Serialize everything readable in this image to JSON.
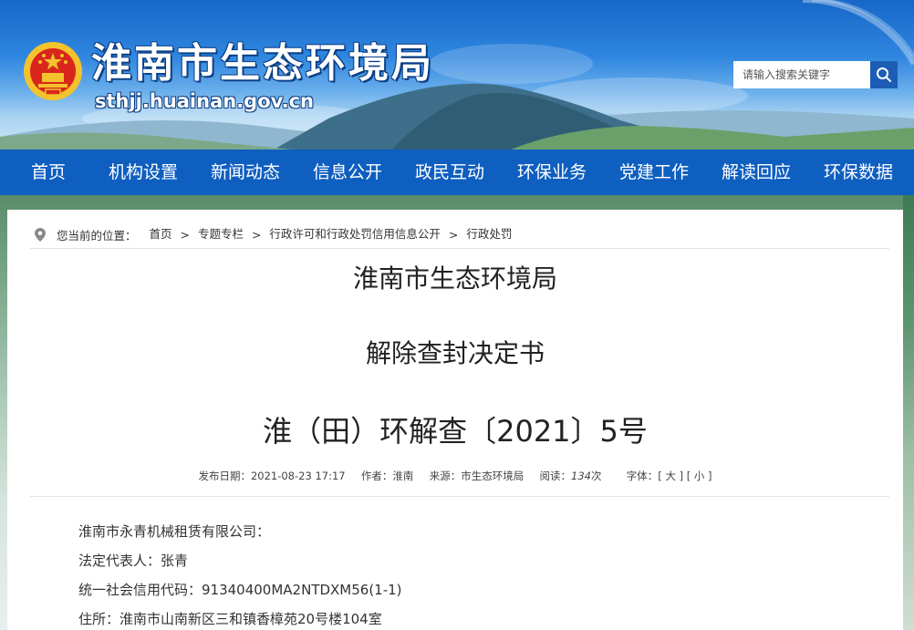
{
  "header": {
    "site_title": "淮南市生态环境局",
    "site_domain": "sthjj.huainan.gov.cn",
    "search_placeholder": "请输入搜索关键字"
  },
  "nav": {
    "items": [
      "首页",
      "机构设置",
      "新闻动态",
      "信息公开",
      "政民互动",
      "环保业务",
      "党建工作",
      "解读回应",
      "环保数据"
    ]
  },
  "breadcrumb": {
    "prefix": "您当前的位置：",
    "items": [
      "首页",
      "专题专栏",
      "行政许可和行政处罚信用信息公开",
      "行政处罚"
    ],
    "separator": ">"
  },
  "article": {
    "agency": "淮南市生态环境局",
    "doc_type": "解除查封决定书",
    "doc_number": "淮（田）环解查〔2021〕5号",
    "meta": {
      "date_label": "发布日期：",
      "date": "2021-08-23 17:17",
      "author_label": "作者：",
      "author": "淮南",
      "source_label": "来源：",
      "source": "市生态环境局",
      "views_label": "阅读：",
      "views": "134",
      "views_unit": "次",
      "font_label": "字体：",
      "font_large": "[ 大 ]",
      "font_small": "[ 小 ]"
    },
    "paragraphs": [
      "淮南市永青机械租赁有限公司：",
      "法定代表人：张青",
      "统一社会信用代码：91340400MA2NTDXM56(1-1)",
      "住所：淮南市山南新区三和镇香樟苑20号楼104室"
    ]
  },
  "colors": {
    "nav_bg": "#0f5fc0",
    "search_button": "#1d5db5"
  }
}
